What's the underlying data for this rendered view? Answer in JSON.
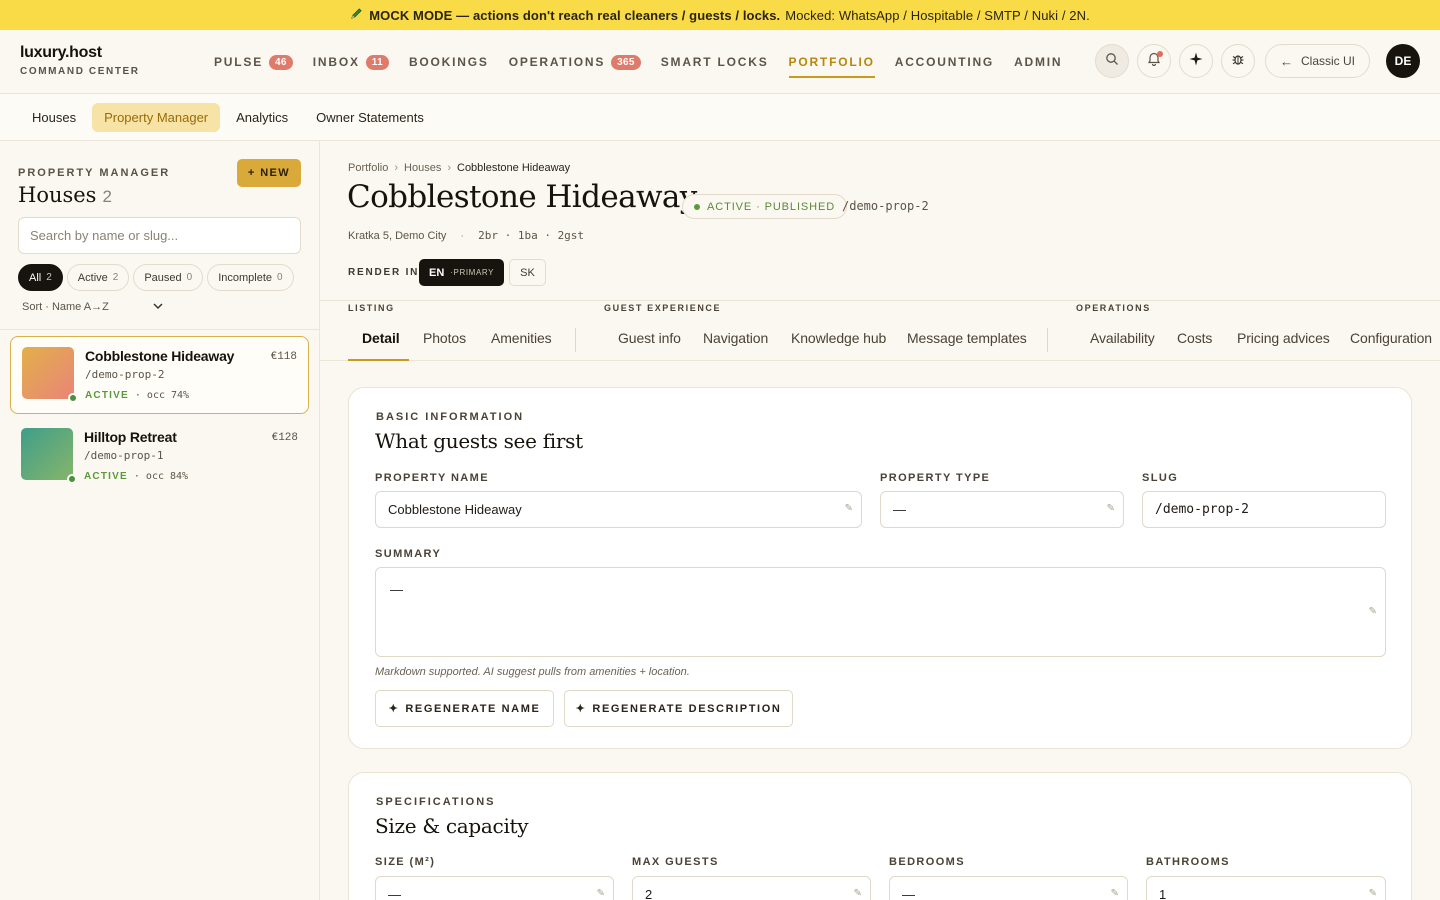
{
  "banner": {
    "icon": "pencil-icon",
    "strong": "MOCK MODE — actions don't reach real cleaners / guests / locks.",
    "rest": "Mocked: WhatsApp / Hospitable / SMTP / Nuki / 2N."
  },
  "brand": {
    "title": "luxury.host",
    "subtitle": "COMMAND CENTER"
  },
  "nav": {
    "items": [
      {
        "label": "PULSE",
        "count": "46"
      },
      {
        "label": "INBOX",
        "count": "11"
      },
      {
        "label": "BOOKINGS",
        "count": ""
      },
      {
        "label": "OPERATIONS",
        "count": "365"
      },
      {
        "label": "SMART LOCKS",
        "count": ""
      },
      {
        "label": "PORTFOLIO",
        "count": ""
      },
      {
        "label": "ACCOUNTING",
        "count": ""
      },
      {
        "label": "ADMIN",
        "count": ""
      }
    ],
    "active": "PORTFOLIO",
    "classic_label": "Classic UI",
    "avatar": "DE",
    "icons": [
      "search-icon",
      "bell-icon",
      "sparkle-icon",
      "bug-icon"
    ]
  },
  "subnav": {
    "tabs": [
      "Houses",
      "Property Manager",
      "Analytics",
      "Owner Statements"
    ],
    "active": "Property Manager"
  },
  "sidebar": {
    "eyebrow": "PROPERTY MANAGER",
    "title": "Houses",
    "count": "2",
    "new_label": "+ NEW",
    "search_placeholder": "Search by name or slug...",
    "filters": [
      {
        "label": "All",
        "count": "2"
      },
      {
        "label": "Active",
        "count": "2"
      },
      {
        "label": "Paused",
        "count": "0"
      },
      {
        "label": "Incomplete",
        "count": "0"
      }
    ],
    "sort_label": "Sort · Name A→Z",
    "houses": [
      {
        "name": "Cobblestone Hideaway",
        "price": "€118",
        "slug": "/demo-prop-2",
        "status": "ACTIVE",
        "occ": " · occ 74%",
        "gradient": [
          "#e2b04a",
          "#ea8478"
        ]
      },
      {
        "name": "Hilltop Retreat",
        "price": "€128",
        "slug": "/demo-prop-1",
        "status": "ACTIVE",
        "occ": " · occ 84%",
        "gradient": [
          "#3f9e8a",
          "#86b56a"
        ]
      }
    ]
  },
  "property": {
    "breadcrumbs": [
      "Portfolio",
      "Houses",
      "Cobblestone Hideaway"
    ],
    "name": "Cobblestone Hideaway",
    "status": "ACTIVE · PUBLISHED",
    "slug": "/demo-prop-2",
    "address": "Kratka 5, Demo City",
    "specs": "2br · 1ba · 2gst",
    "render_label": "RENDER IN",
    "lang_primary": "EN",
    "lang_primary_tag": "·PRIMARY",
    "lang_secondary": "SK"
  },
  "tabs": {
    "groups": [
      "LISTING",
      "GUEST EXPERIENCE",
      "OPERATIONS"
    ],
    "listing": [
      "Detail",
      "Photos",
      "Amenities"
    ],
    "guest": [
      "Guest info",
      "Navigation",
      "Knowledge hub",
      "Message templates"
    ],
    "operations": [
      "Availability",
      "Costs",
      "Pricing advices",
      "Configuration"
    ],
    "active": "Detail"
  },
  "basic": {
    "eyebrow": "BASIC INFORMATION",
    "title": "What guests see first",
    "name_label": "PROPERTY NAME",
    "name_value": "Cobblestone Hideaway",
    "type_label": "PROPERTY TYPE",
    "type_value": "—",
    "slug_label": "SLUG",
    "slug_value": "/demo-prop-2",
    "summary_label": "SUMMARY",
    "summary_value": "—",
    "hint": "Markdown supported. AI suggest pulls from amenities + location.",
    "regen_name": "REGENERATE NAME",
    "regen_desc": "REGENERATE DESCRIPTION"
  },
  "specs_card": {
    "eyebrow": "SPECIFICATIONS",
    "title": "Size & capacity",
    "fields": [
      {
        "label": "SIZE (M²)",
        "value": "—"
      },
      {
        "label": "MAX GUESTS",
        "value": "2"
      },
      {
        "label": "BEDROOMS",
        "value": "—"
      },
      {
        "label": "BATHROOMS",
        "value": "1"
      }
    ]
  }
}
